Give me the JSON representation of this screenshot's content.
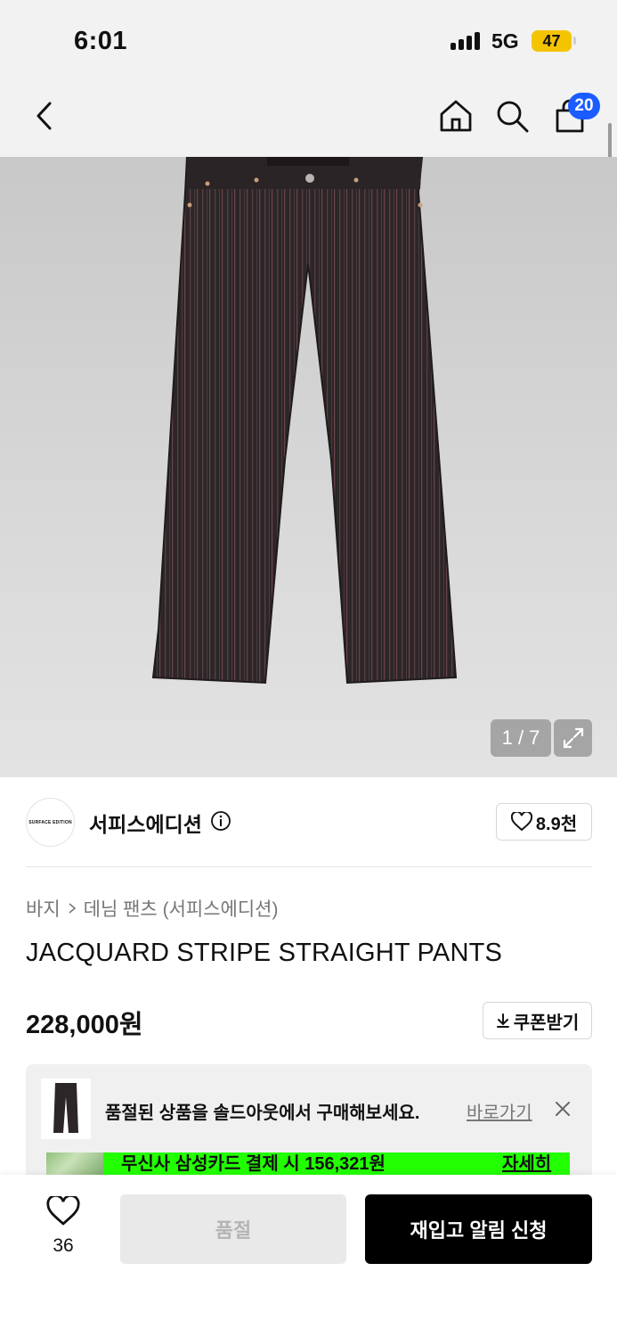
{
  "status_bar": {
    "time": "6:01",
    "network": "5G",
    "battery": "47"
  },
  "header": {
    "cart_badge": "20"
  },
  "gallery": {
    "counter": "1 / 7"
  },
  "brand": {
    "name": "서피스에디션",
    "logo_text": "SURFACE EDITION",
    "likes": "8.9천"
  },
  "product": {
    "breadcrumb": [
      "바지",
      "데님 팬츠 (서피스에디션)"
    ],
    "title": "JACQUARD STRIPE STRAIGHT PANTS",
    "price": "228,000원",
    "coupon_label": "쿠폰받기"
  },
  "soldout_banner": {
    "text": "품절된 상품을 솔드아웃에서 구매해보세요.",
    "link": "바로가기"
  },
  "promo": {
    "text": "무신사 삼성카드 결제 시 156,321원",
    "more": "자세히"
  },
  "bottom_bar": {
    "like_count": "36",
    "soldout_label": "품절",
    "restock_label": "재입고 알림 신청"
  },
  "colors": {
    "accent_badge": "#1a5cff",
    "promo_bg": "#22ff00",
    "primary_button": "#000000"
  }
}
